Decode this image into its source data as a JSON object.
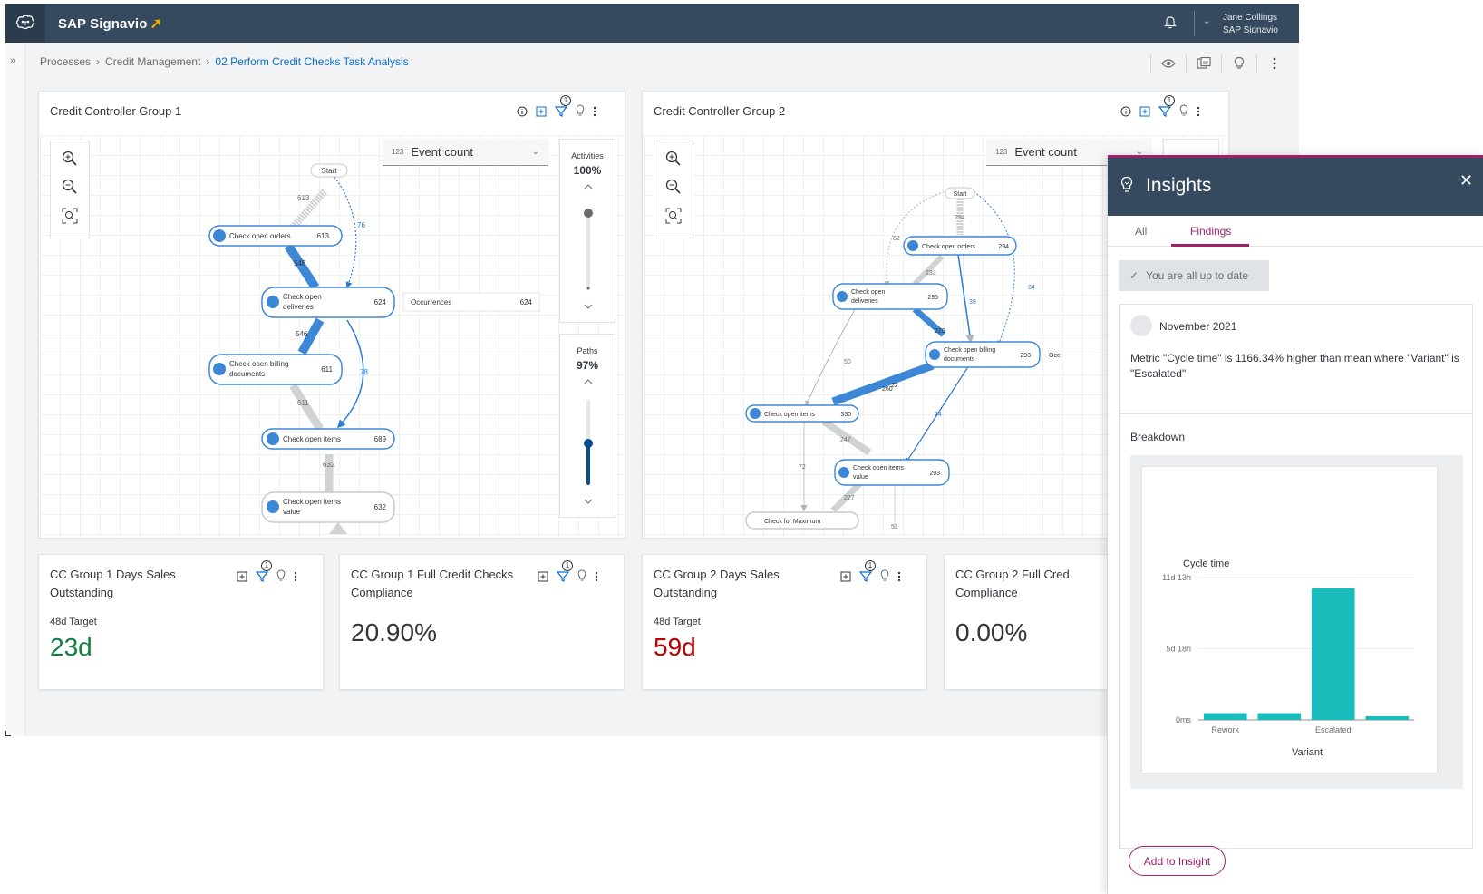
{
  "app": {
    "brand": "SAP Signavio",
    "user_name": "Jane Collings",
    "user_org": "SAP Signavio"
  },
  "breadcrumb": {
    "items": [
      "Processes",
      "Credit Management"
    ],
    "current": "02 Perform Credit Checks Task Analysis"
  },
  "widgets": {
    "group1": {
      "title": "Credit Controller Group 1",
      "metric_select": "Event count",
      "activities_label": "Activities",
      "activities_value": "100%",
      "paths_label": "Paths",
      "paths_value": "97%",
      "occurrences_label": "Occurrences",
      "occurrences_value": "624",
      "nodes": [
        {
          "label": "Start",
          "count": ""
        },
        {
          "label": "Check open orders",
          "count": "613"
        },
        {
          "label": "Check open deliveries",
          "count": "624"
        },
        {
          "label": "Check open billing documents",
          "count": "611"
        },
        {
          "label": "Check open items",
          "count": "689"
        },
        {
          "label": "Check open items value",
          "count": "632"
        }
      ],
      "edges": [
        "613",
        "76",
        "548",
        "546",
        "78",
        "611",
        "632"
      ]
    },
    "group2": {
      "title": "Credit Controller Group 2",
      "metric_select": "Event count",
      "occ_short": "Occ",
      "nodes": [
        {
          "label": "Start",
          "count": ""
        },
        {
          "label": "Check open orders",
          "count": "294"
        },
        {
          "label": "Check open deliveries",
          "count": "295"
        },
        {
          "label": "Check open billing documents",
          "count": "293"
        },
        {
          "label": "Check open items",
          "count": "330"
        },
        {
          "label": "Check open items value",
          "count": "293"
        },
        {
          "label": "Check for Maximum",
          "count": ""
        }
      ],
      "edges": [
        "294",
        "62",
        "233",
        "39",
        "34",
        "220",
        "50",
        "260",
        "22",
        "24",
        "247",
        "72",
        "227",
        "51"
      ]
    }
  },
  "kpis": [
    {
      "title_1": "CC Group 1 Days Sales",
      "title_2": "Outstanding",
      "target": "48d Target",
      "value": "23d",
      "color": "#107e3e"
    },
    {
      "title_1": "CC Group 1 Full Credit Checks",
      "title_2": "Compliance",
      "target": "",
      "value": "20.90%",
      "color": "#32363a"
    },
    {
      "title_1": "CC Group 2 Days Sales",
      "title_2": "Outstanding",
      "target": "48d Target",
      "value": "59d",
      "color": "#bb0000"
    },
    {
      "title_1": "CC Group 2 Full Cred",
      "title_2": "Compliance",
      "target": "",
      "value": "0.00%",
      "color": "#32363a"
    }
  ],
  "filter_badge": "1",
  "insights": {
    "title": "Insights",
    "tabs": [
      "All",
      "Findings"
    ],
    "active_tab": "Findings",
    "status": "You are all up to date",
    "finding_date": "November 2021",
    "finding_text": "Metric \"Cycle time\" is 1166.34% higher than mean where \"Variant\" is \"Escalated\"",
    "breakdown_label": "Breakdown",
    "add_button": "Add to Insight"
  },
  "chart_data": {
    "type": "bar",
    "title": "",
    "ylabel": "Cycle time",
    "xlabel": "Variant",
    "y_tick_labels": [
      "11d 13h",
      "5d 18h",
      "0ms"
    ],
    "ylim_days": [
      0,
      11.54
    ],
    "categories": [
      "Rework",
      "",
      "Escalated",
      ""
    ],
    "category_tick_labels": [
      "Rework",
      "Escalated"
    ],
    "values_days": [
      0.55,
      0.55,
      10.7,
      0.3
    ],
    "color": "#1bbcbc",
    "grid": true
  }
}
